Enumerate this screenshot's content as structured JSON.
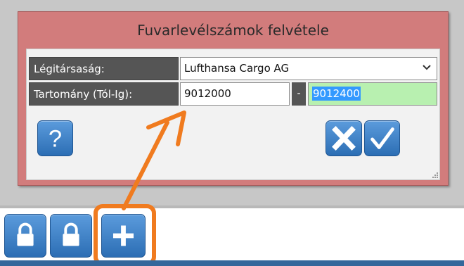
{
  "dialog": {
    "title": "Fuvarlevélszámok felvétele"
  },
  "form": {
    "airline_label": "Légitársaság:",
    "airline_value": "Lufthansa Cargo AG",
    "range_label": "Tartomány (Tól-Ig):",
    "range_from": "9012000",
    "range_separator": "-",
    "range_to": "9012400"
  },
  "buttons": {
    "help": "?",
    "cancel": "✕",
    "confirm": "✓"
  },
  "toolbar": {
    "buttons": [
      "lock-icon",
      "lock-icon",
      "plus-icon"
    ]
  },
  "colors": {
    "dialog_header": "#d27c7c",
    "button_blue": "#2c6eb4",
    "highlight_orange": "#f07b1f",
    "range_to_bg": "#b8f0b0"
  }
}
